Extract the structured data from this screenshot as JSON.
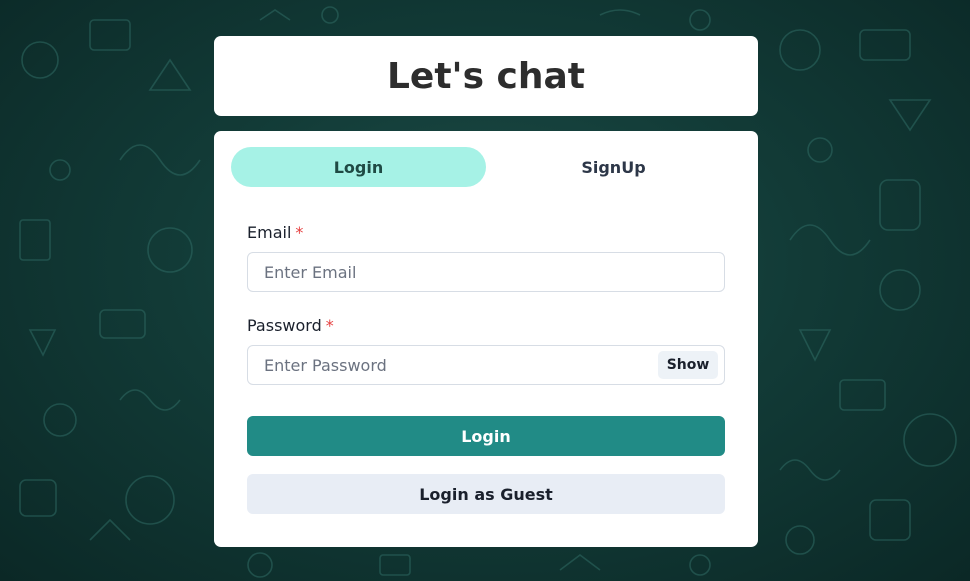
{
  "header": {
    "title": "Let's chat"
  },
  "tabs": [
    {
      "label": "Login",
      "active": true
    },
    {
      "label": "SignUp",
      "active": false
    }
  ],
  "form": {
    "email": {
      "label": "Email",
      "required_mark": "*",
      "placeholder": "Enter Email",
      "value": ""
    },
    "password": {
      "label": "Password",
      "required_mark": "*",
      "placeholder": "Enter Password",
      "value": "",
      "toggle_label": "Show"
    },
    "login_button": "Login",
    "guest_button": "Login as Guest"
  },
  "colors": {
    "accent": "#218b86",
    "active_tab": "#a6f2e6",
    "required": "#e53e3e",
    "background": "#123b37"
  }
}
